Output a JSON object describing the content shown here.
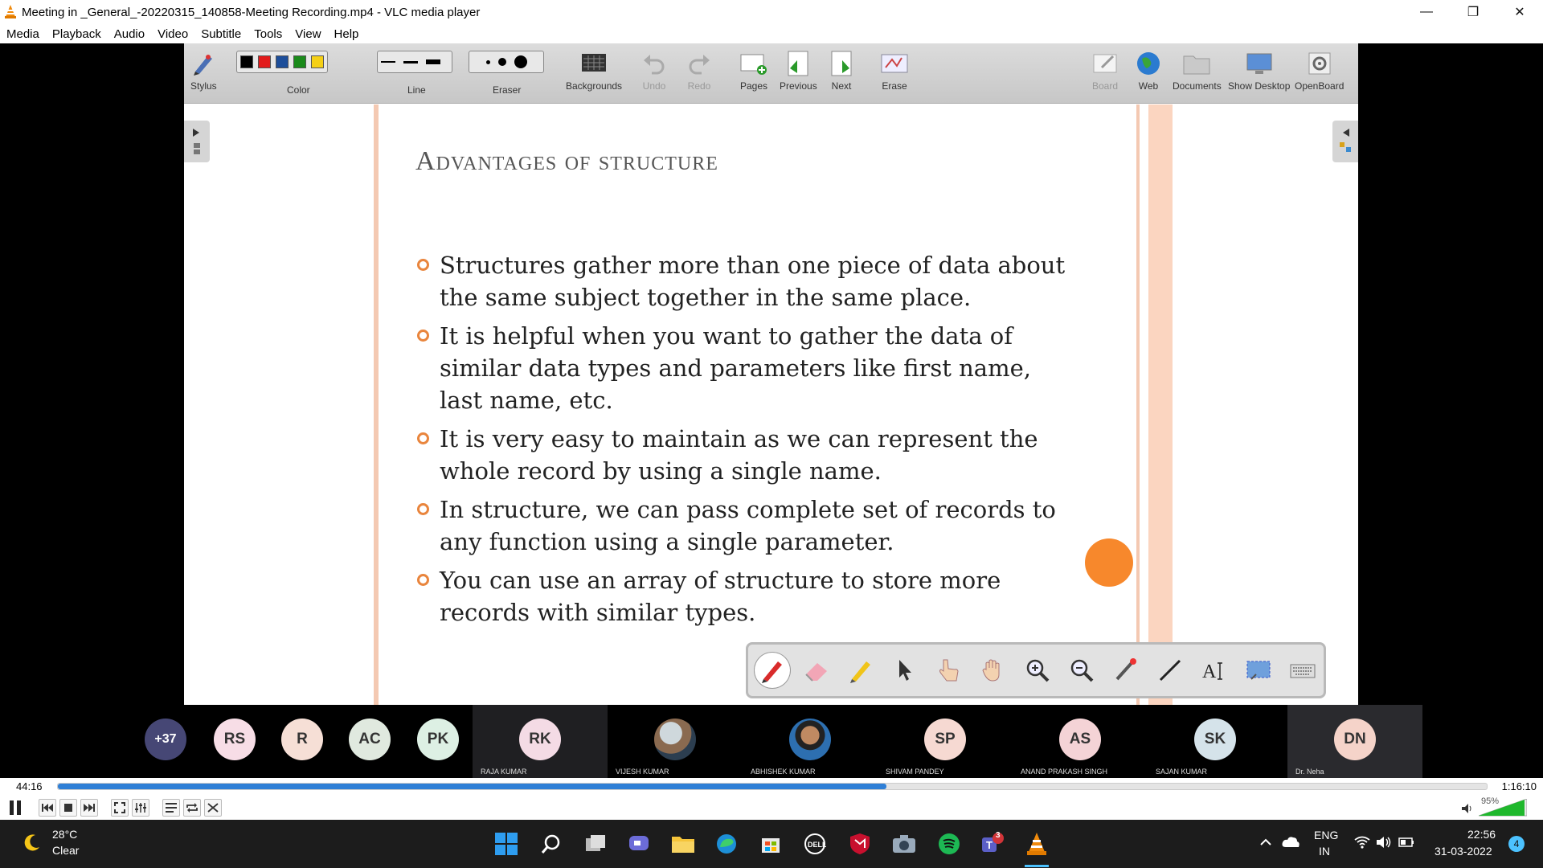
{
  "window": {
    "title": "Meeting in _General_-20220315_140858-Meeting Recording.mp4 - VLC media player",
    "buttons": [
      "minimize",
      "restore",
      "close"
    ]
  },
  "menu": [
    "Media",
    "Playback",
    "Audio",
    "Video",
    "Subtitle",
    "Tools",
    "View",
    "Help"
  ],
  "openboard": {
    "toolbar": {
      "stylus": "Stylus",
      "color": "Color",
      "colors": [
        "#000000",
        "#e21b1b",
        "#1d4e9a",
        "#1a8a1a",
        "#f5d016"
      ],
      "line": "Line",
      "eraser": "Eraser",
      "backgrounds": "Backgrounds",
      "undo": "Undo",
      "redo": "Redo",
      "pages": "Pages",
      "previous": "Previous",
      "next": "Next",
      "erase": "Erase",
      "board": "Board",
      "web": "Web",
      "documents": "Documents",
      "show_desktop": "Show Desktop",
      "openboard": "OpenBoard"
    },
    "slide": {
      "title": "Advantages of structure",
      "bullets": [
        "Structures gather more than one piece of data about the same subject together in the same place.",
        "It is helpful when you want to gather the data of similar data types and parameters like first name, last name, etc.",
        "It is very easy to maintain as we can represent the whole record by using a single name.",
        "In structure, we can pass complete set of records to any function using a single parameter.",
        "You can use an array of structure to store more records with similar types."
      ],
      "accent": "#e9853d"
    }
  },
  "participants": {
    "overflow": "+37",
    "initials": [
      "RS",
      "R",
      "AC",
      "PK"
    ],
    "tiles": [
      {
        "initials": "RK",
        "name": "RAJA KUMAR"
      },
      {
        "initials": "",
        "name": "VIJESH KUMAR"
      },
      {
        "initials": "",
        "name": "ABHISHEK KUMAR"
      },
      {
        "initials": "SP",
        "name": "SHIVAM PANDEY"
      },
      {
        "initials": "AS",
        "name": "ANAND PRAKASH SINGH"
      },
      {
        "initials": "SK",
        "name": "SAJAN KUMAR"
      },
      {
        "initials": "DN",
        "name": "Dr. Neha"
      }
    ]
  },
  "player": {
    "elapsed": "44:16",
    "duration": "1:16:10",
    "progress_fraction": 0.58,
    "volume_label": "95%",
    "volume_fraction": 0.95
  },
  "taskbar": {
    "weather_temp": "28°C",
    "weather_cond": "Clear",
    "lang_1": "ENG",
    "lang_2": "IN",
    "time": "22:56",
    "date": "31-03-2022",
    "notifications": "4",
    "teams_badge": "3"
  }
}
